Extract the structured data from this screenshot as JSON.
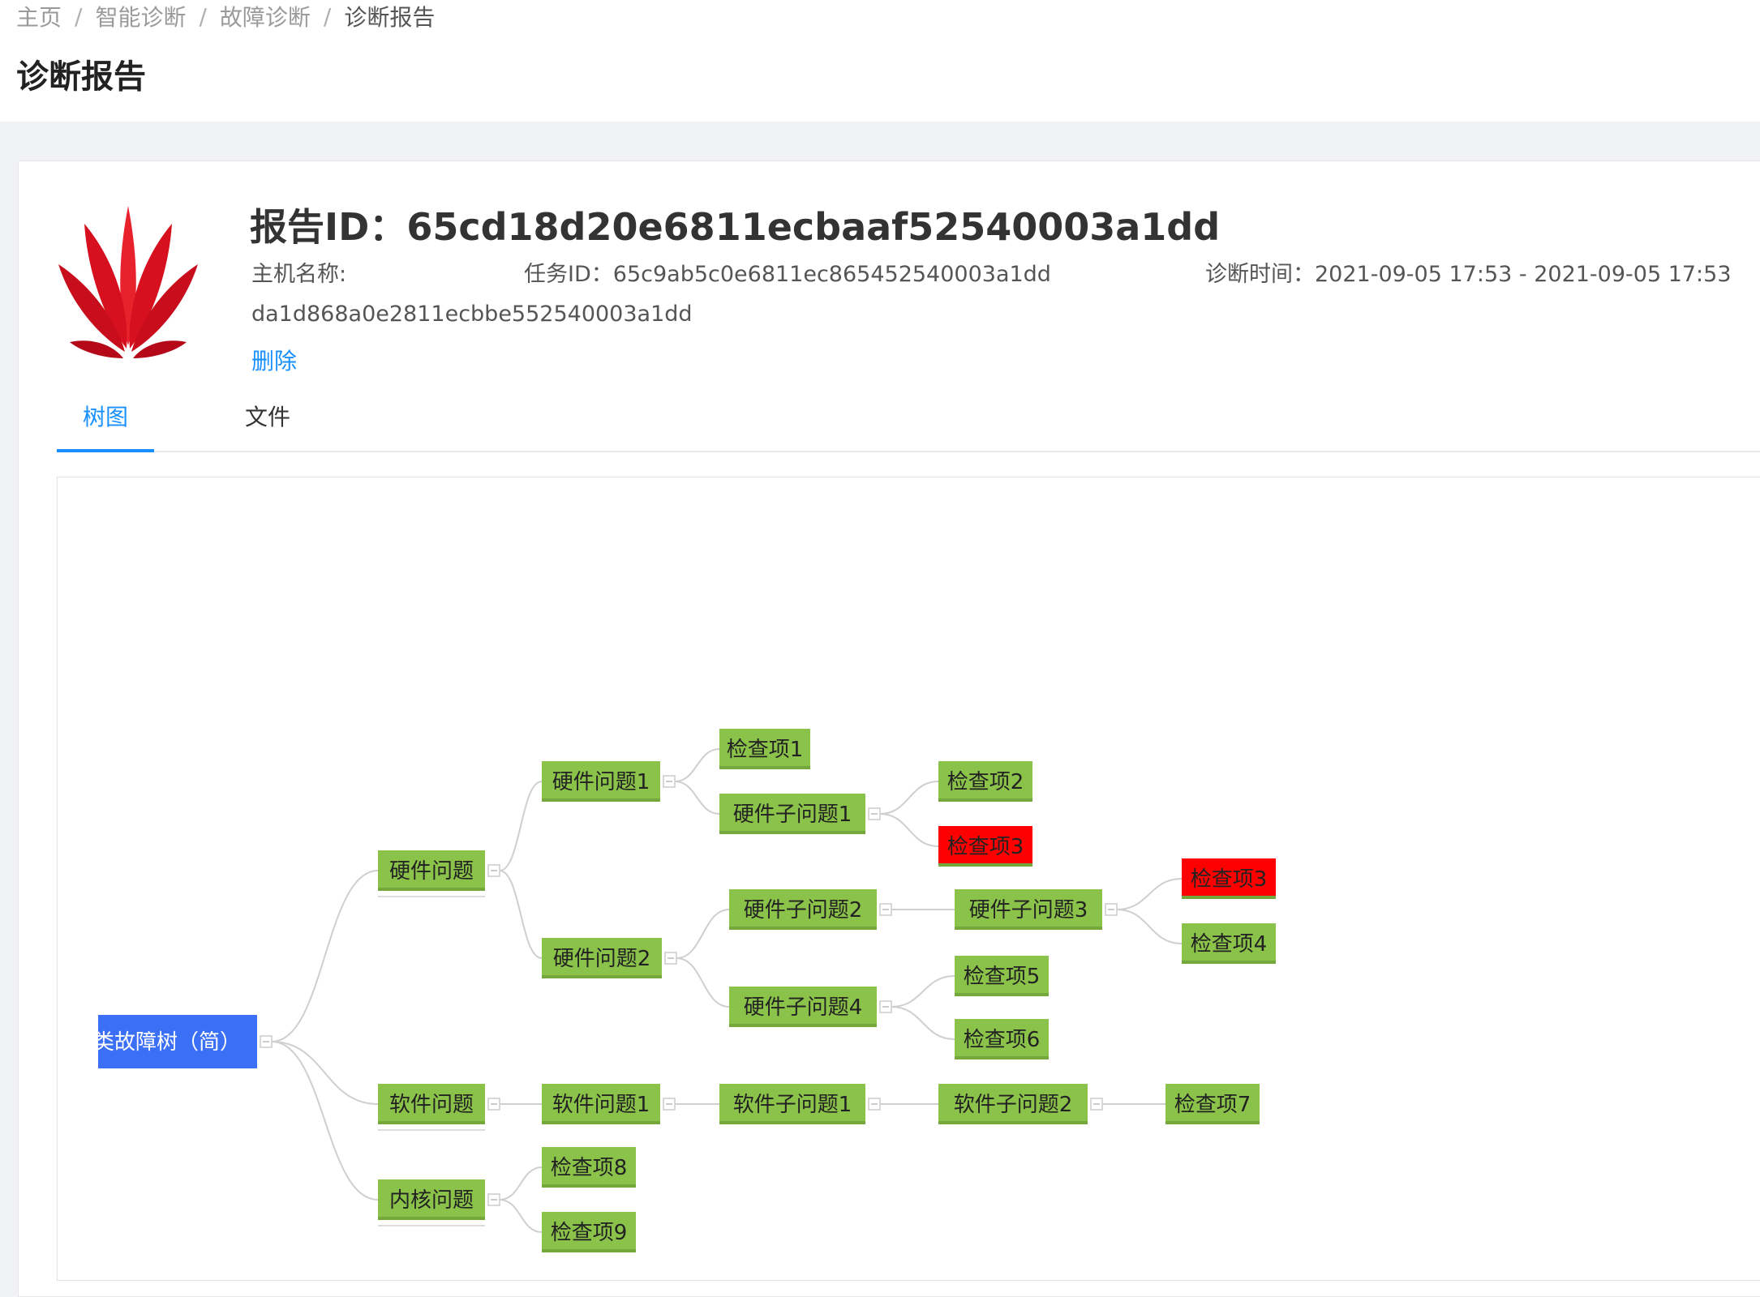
{
  "breadcrumb": [
    "主页",
    "智能诊断",
    "故障诊断",
    "诊断报告"
  ],
  "page_title": "诊断报告",
  "report": {
    "id_label": "报告ID：",
    "id": "65cd18d20e6811ecbaaf52540003a1dd",
    "host_label": "主机名称:",
    "host_value": "da1d868a0e2811ecbbe552540003a1dd",
    "task_label": "任务ID：",
    "task_id": "65c9ab5c0e6811ec865452540003a1dd",
    "time_label": "诊断时间：",
    "time_value": "2021-09-05 17:53 - 2021-09-05 17:53",
    "delete_label": "删除"
  },
  "tabs": [
    "树图",
    "文件"
  ],
  "colors": {
    "accent": "#1890ff",
    "node_ok": "#8bc34a",
    "node_fail": "#ff0000",
    "root": "#3b6ff5",
    "logo_red": "#cf0a2c"
  },
  "tree": {
    "label": "类故障树（简）",
    "children": [
      {
        "label": "硬件问题",
        "children": [
          {
            "label": "硬件问题1",
            "children": [
              {
                "label": "检查项1"
              },
              {
                "label": "硬件子问题1",
                "children": [
                  {
                    "label": "检查项2"
                  },
                  {
                    "label": "检查项3",
                    "status": "fail"
                  }
                ]
              }
            ]
          },
          {
            "label": "硬件问题2",
            "children": [
              {
                "label": "硬件子问题2",
                "children": [
                  {
                    "label": "硬件子问题3",
                    "children": [
                      {
                        "label": "检查项3",
                        "status": "fail"
                      },
                      {
                        "label": "检查项4"
                      }
                    ]
                  }
                ]
              },
              {
                "label": "硬件子问题4",
                "children": [
                  {
                    "label": "检查项5"
                  },
                  {
                    "label": "检查项6"
                  }
                ]
              }
            ]
          }
        ]
      },
      {
        "label": "软件问题",
        "children": [
          {
            "label": "软件问题1",
            "children": [
              {
                "label": "软件子问题1",
                "children": [
                  {
                    "label": "软件子问题2",
                    "children": [
                      {
                        "label": "检查项7"
                      }
                    ]
                  }
                ]
              }
            ]
          }
        ]
      },
      {
        "label": "内核问题",
        "children": [
          {
            "label": "检查项8"
          },
          {
            "label": "检查项9"
          }
        ]
      }
    ]
  }
}
